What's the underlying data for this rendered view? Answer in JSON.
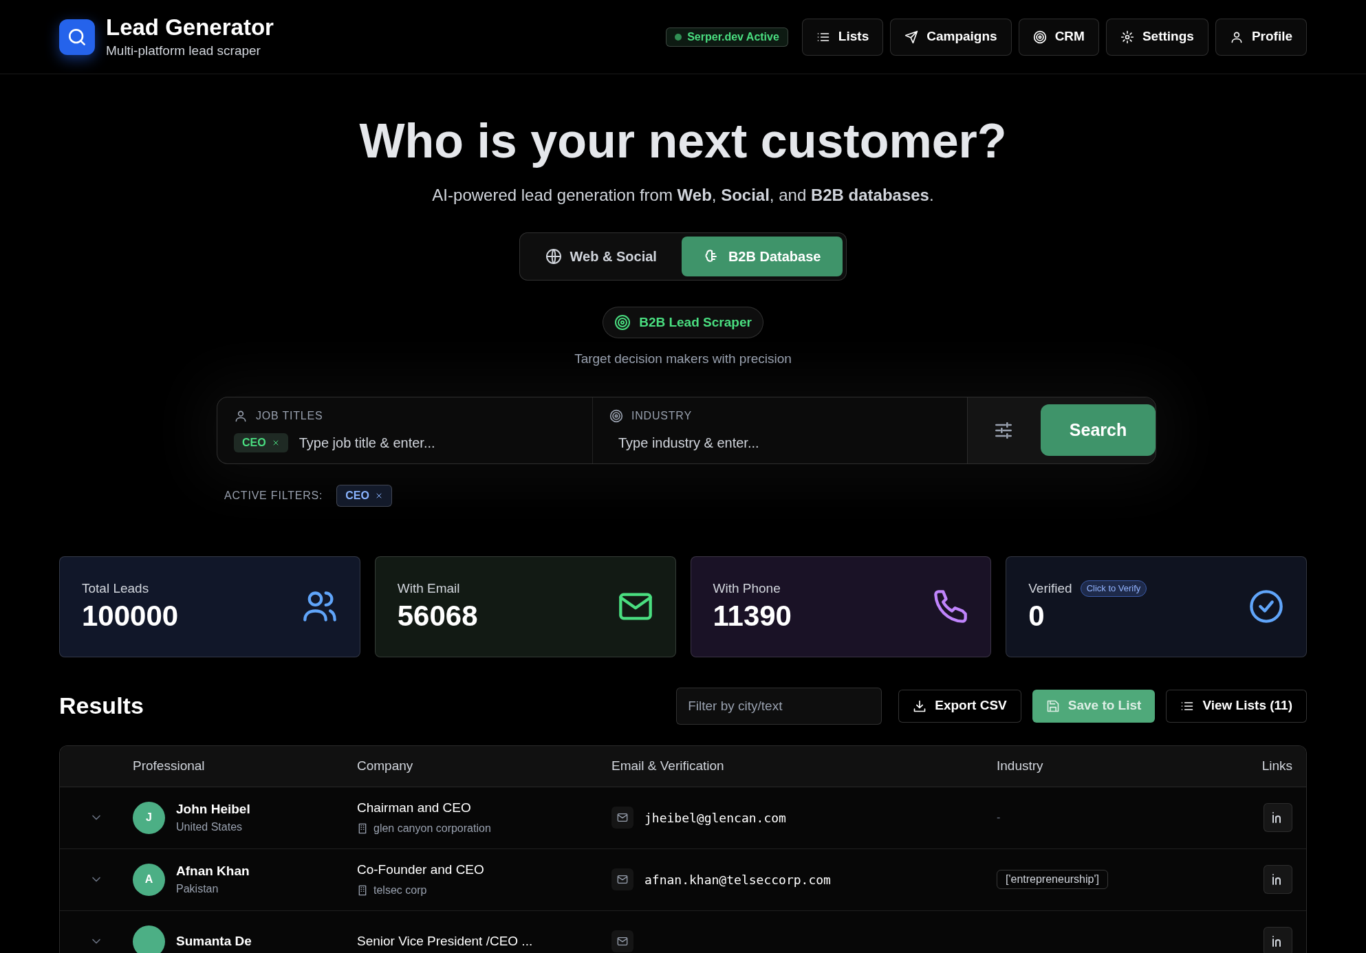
{
  "header": {
    "title": "Lead Generator",
    "subtitle": "Multi-platform lead scraper",
    "status": {
      "label": "Serper.dev Active",
      "active": true
    },
    "nav": [
      {
        "label": "Lists",
        "kind": "list"
      },
      {
        "label": "Campaigns",
        "kind": "send"
      },
      {
        "label": "CRM",
        "kind": "target"
      },
      {
        "label": "Settings",
        "kind": "gear"
      },
      {
        "label": "Profile",
        "kind": "user"
      }
    ]
  },
  "hero": {
    "heading": "Who is your next customer?",
    "subheading": "AI-powered lead generation from **Web**, **Social**, and **B2B databases**.",
    "modes": [
      {
        "label": "Web & Social",
        "kind": "globe",
        "selected": false
      },
      {
        "label": "B2B Database",
        "kind": "brain",
        "selected": true
      }
    ],
    "badge": "B2B Lead Scraper",
    "tagline": "Target decision makers with precision"
  },
  "search": {
    "fields": [
      {
        "label": "JOB TITLES",
        "kind": "user",
        "tags": [
          "CEO"
        ],
        "placeholder": "Type job title & enter..."
      },
      {
        "label": "INDUSTRY",
        "kind": "target",
        "placeholder": "Type industry & enter..."
      }
    ],
    "button": "Search",
    "active_filters_label": "ACTIVE FILTERS:",
    "active_filters": [
      "CEO"
    ]
  },
  "stats": [
    {
      "label": "Total Leads",
      "value": "100000",
      "kind": "users",
      "color": "#60a5fa"
    },
    {
      "label": "With Email",
      "value": "56068",
      "kind": "mail",
      "color": "#4ade80"
    },
    {
      "label": "With Phone",
      "value": "11390",
      "kind": "phone",
      "color": "#c084fc"
    },
    {
      "label": "Verified",
      "value": "0",
      "kind": "check",
      "color": "#60a5fa",
      "action": "Click to Verify"
    }
  ],
  "results": {
    "title": "Results",
    "filter_placeholder": "Filter by city/text",
    "buttons": [
      {
        "label": "Export CSV",
        "kind": "export"
      },
      {
        "label": "Save to List",
        "kind": "save"
      },
      {
        "label": "View Lists (11)",
        "kind": "view"
      }
    ],
    "columns": [
      "Professional",
      "Company",
      "Email & Verification",
      "Industry",
      "Links"
    ],
    "rows": [
      {
        "initial": "J",
        "name": "John Heibel",
        "location": "United States",
        "title": "Chairman and CEO",
        "company": "glen canyon corporation",
        "email": "jheibel@glencan.com",
        "industry": "-",
        "kind": "plain"
      },
      {
        "initial": "A",
        "name": "Afnan Khan",
        "location": "Pakistan",
        "title": "Co-Founder and CEO",
        "company": "telsec corp",
        "email": "afnan.khan@telseccorp.com",
        "industry": "['entrepreneurship']",
        "kind": "tag"
      },
      {
        "name": "Sumanta De",
        "title": "Senior Vice President /CEO ..."
      }
    ]
  }
}
